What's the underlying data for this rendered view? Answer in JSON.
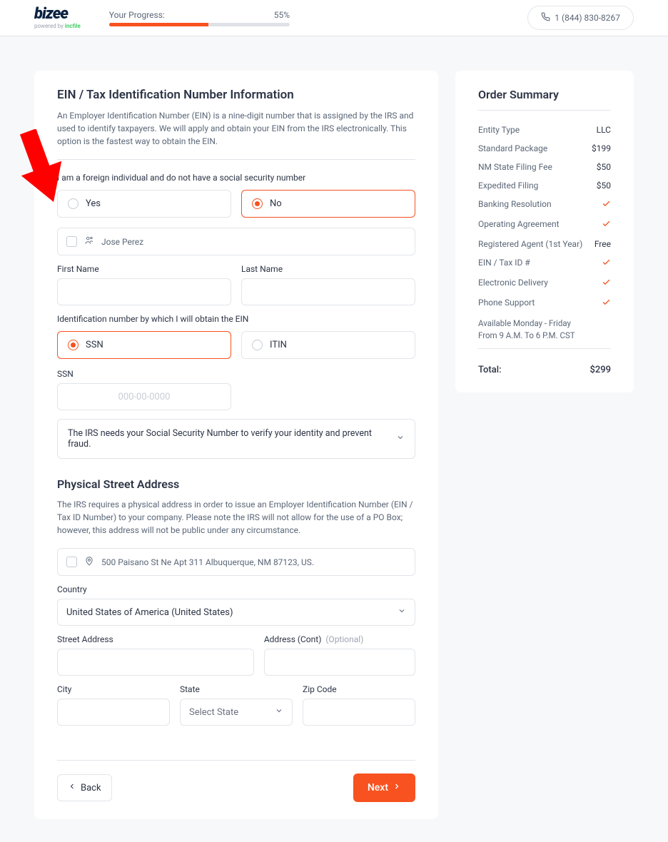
{
  "header": {
    "logo": "bizee",
    "logo_sub_prefix": "powered by ",
    "logo_sub_brand": "incfile",
    "progress_label": "Your Progress:",
    "progress_pct_text": "55%",
    "progress_pct": 55,
    "phone": "1 (844) 830-8267"
  },
  "ein": {
    "title": "EIN / Tax Identification Number Information",
    "desc": "An Employer Identification Number (EIN) is a nine-digit number that is assigned by the IRS and used to identify taxpayers. We will apply and obtain your EIN from the IRS electronically. This option is the fastest way to obtain the EIN.",
    "foreign_q": "I am a foreign individual and do not have a social security number",
    "opt_yes": "Yes",
    "opt_no": "No",
    "copy_name": "Jose Perez",
    "first_name_label": "First Name",
    "last_name_label": "Last Name",
    "id_num_q": "Identification number by which I will obtain the EIN",
    "opt_ssn": "SSN",
    "opt_itin": "ITIN",
    "ssn_label": "SSN",
    "ssn_placeholder": "000-00-0000",
    "ssn_info": "The IRS needs your Social Security Number to verify your identity and prevent fraud."
  },
  "addr": {
    "title": "Physical Street Address",
    "desc_a": "The IRS requires a physical address in order to issue an Employer Identification Number (EIN / Tax ID Number) to your company. ",
    "desc_b": "Please note the IRS will not allow for the use of a PO Box; however, this address will not be public under any circumstance.",
    "copy_addr": "500 Paisano St Ne Apt 311 Albuquerque, NM 87123, US.",
    "country_label": "Country",
    "country_value": "United States of America (United States)",
    "street_label": "Street Address",
    "cont_label": "Address (Cont)",
    "cont_optional": "(Optional)",
    "city_label": "City",
    "state_label": "State",
    "state_placeholder": "Select State",
    "zip_label": "Zip Code"
  },
  "nav": {
    "back": "Back",
    "next": "Next"
  },
  "summary": {
    "title": "Order Summary",
    "rows": [
      {
        "k": "Entity Type",
        "v": "LLC"
      },
      {
        "k": "Standard Package",
        "v": "$199"
      },
      {
        "k": "NM State Filing Fee",
        "v": "$50"
      },
      {
        "k": "Expedited Filing",
        "v": "$50"
      },
      {
        "k": "Banking Resolution",
        "check": true
      },
      {
        "k": "Operating Agreement",
        "check": true
      },
      {
        "k": "Registered Agent (1st Year)",
        "v": "Free"
      },
      {
        "k": "EIN / Tax ID #",
        "check": true
      },
      {
        "k": "Electronic Delivery",
        "check": true
      },
      {
        "k": "Phone Support",
        "check": true
      }
    ],
    "hours_a": "Available Monday - Friday",
    "hours_b": "From 9 A.M. To 6 P.M. CST",
    "total_label": "Total:",
    "total_value": "$299"
  }
}
